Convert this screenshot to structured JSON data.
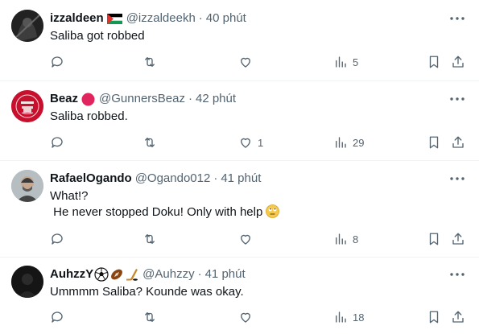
{
  "tweets": [
    {
      "name": "izzaldeen",
      "flag_icon": "palestine-flag-icon",
      "handle": "@izzaldeekh",
      "sep": "·",
      "time": "40 phút",
      "text_lines": [
        "Saliba got robbed"
      ],
      "likes": "",
      "views": "5"
    },
    {
      "name": "Beaz",
      "badge_icon": "red-circle-icon",
      "handle": "@GunnersBeaz",
      "sep": "·",
      "time": "42 phút",
      "text_lines": [
        "Saliba robbed."
      ],
      "likes": "1",
      "views": "29"
    },
    {
      "name": "RafaelOgando",
      "handle": "@Ogando012",
      "sep": "·",
      "time": "41 phút",
      "text_lines": [
        "What!?",
        " He never stopped Doku! Only with help"
      ],
      "emoji_icon": "face-with-rolling-eyes-emoji-icon",
      "likes": "",
      "views": "8"
    },
    {
      "name": "AuhzzY",
      "emoji_icons": [
        "soccer-ball-icon",
        "american-football-icon",
        "hockey-stick-icon"
      ],
      "handle": "@Auhzzy",
      "sep": "·",
      "time": "41 phút",
      "text_lines": [
        "Ummmm Saliba? Kounde was okay."
      ],
      "likes": "",
      "views": "18"
    }
  ],
  "icons": {
    "more": "more-options-icon",
    "reply": "reply-icon",
    "retweet": "retweet-icon",
    "like": "like-heart-icon",
    "views": "views-bar-chart-icon",
    "bookmark": "bookmark-icon",
    "share": "share-icon"
  },
  "colors": {
    "text": "#0f1419",
    "secondary": "#536471",
    "divider": "#eff3f4",
    "beaz_badge": "#e0245e",
    "arsenal_red": "#db0007"
  }
}
